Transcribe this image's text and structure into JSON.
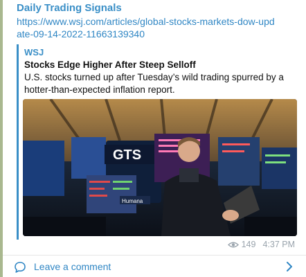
{
  "post": {
    "channel": "Daily Trading Signals",
    "link": "https://www.wsj.com/articles/global-stocks-markets-dow-update-09-14-2022-11663139340",
    "views": "149",
    "time": "4:37 PM"
  },
  "preview": {
    "site": "WSJ",
    "title": "Stocks Edge Higher After Steep Selloff",
    "description": "U.S. stocks turned up after Tuesday’s wild trading spurred by a hotter-than-expected inflation report.",
    "image_sign": "GTS",
    "image_banner": "Humana"
  },
  "footer": {
    "comment_label": "Leave a comment"
  },
  "colors": {
    "accent": "#3a8fc7",
    "background": "#a9b88f"
  },
  "icons": {
    "views": "eye-icon",
    "comment": "comment-bubble-icon",
    "chevron": "chevron-right-icon"
  }
}
